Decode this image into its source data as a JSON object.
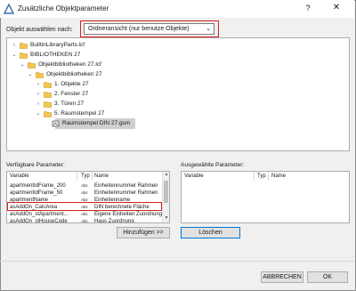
{
  "window": {
    "title": "Zusätzliche Objektparameter",
    "help": "?",
    "close": "✕"
  },
  "selector": {
    "label": "Objekt auswählen nach:",
    "value": "Ordneransicht (nur benutze Objekte)"
  },
  "tree": [
    {
      "label": "BuiltinLibraryParts.lcf",
      "icon": "folder-icon",
      "expanded": false
    },
    {
      "label": "BIBLIOTHEKEN 27",
      "icon": "folder-icon",
      "expanded": true
    },
    {
      "label": "Objektbibliotheken 27.lcf",
      "icon": "folder-icon",
      "expanded": true
    },
    {
      "label": "Objektbibliotheken 27",
      "icon": "folder-icon",
      "expanded": true
    },
    {
      "label": "1. Objekte 27",
      "icon": "folder-icon",
      "expanded": false
    },
    {
      "label": "2. Fenster 27",
      "icon": "folder-icon",
      "expanded": false
    },
    {
      "label": "3. Türen 27",
      "icon": "folder-icon",
      "expanded": false
    },
    {
      "label": "5. Raumstempel 27",
      "icon": "folder-icon",
      "expanded": true
    },
    {
      "label": "Raumstempel DIN 27.gsm",
      "icon": "object-icon",
      "selected": true
    }
  ],
  "available": {
    "label": "Verfügbare Parameter:",
    "headers": {
      "variable": "Variable",
      "type": "Typ",
      "name": "Name"
    },
    "rows": [
      {
        "variable": "apartmentIdFrame_200",
        "type": "Abc",
        "name": "Einheitennummer Rahmen"
      },
      {
        "variable": "apartmentIdFrame_50",
        "type": "Abc",
        "name": "Einheitennummer Rahmen"
      },
      {
        "variable": "apartmentName",
        "type": "Abc",
        "name": "Einheitenname"
      },
      {
        "variable": "asAddOn_CalcArea",
        "type": "Abc",
        "name": "DIN berechnete Fläche",
        "highlighted": true
      },
      {
        "variable": "asAddOn_stApartment...",
        "type": "Abc",
        "name": "Eigene Einheiten Zuordnung"
      },
      {
        "variable": "asAddOn_stHouseCode",
        "type": "Abc",
        "name": "Haus Zuordnung"
      }
    ]
  },
  "selected_params": {
    "label": "Ausgewählte Parameter:",
    "headers": {
      "variable": "Variable",
      "type": "Typ",
      "name": "Name"
    }
  },
  "buttons": {
    "add": "Hinzufügen >>",
    "delete": "Löschen",
    "cancel": "ABBRECHEN",
    "ok": "OK"
  },
  "colors": {
    "highlight_border": "#d42020",
    "selection": "#cfcfcf",
    "folder": "#f3c64b",
    "focus": "#0078d7"
  }
}
